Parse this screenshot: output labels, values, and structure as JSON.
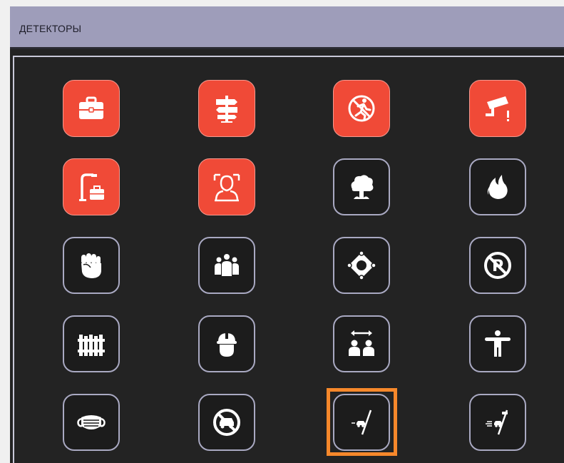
{
  "header": {
    "title": "ДЕТЕКТОРЫ"
  },
  "detectors": [
    {
      "icon": "briefcase-icon",
      "style": "red",
      "selected": false
    },
    {
      "icon": "signpost-icon",
      "style": "red",
      "selected": false
    },
    {
      "icon": "no-running-icon",
      "style": "red",
      "selected": false
    },
    {
      "icon": "camera-tamper-icon",
      "style": "red",
      "selected": false
    },
    {
      "icon": "abandoned-object-icon",
      "style": "red",
      "selected": false
    },
    {
      "icon": "face-frame-icon",
      "style": "red",
      "selected": false
    },
    {
      "icon": "smoke-icon",
      "style": "dark",
      "selected": false
    },
    {
      "icon": "fire-icon",
      "style": "dark",
      "selected": false
    },
    {
      "icon": "fist-icon",
      "style": "dark",
      "selected": false
    },
    {
      "icon": "crowd-icon",
      "style": "dark",
      "selected": false
    },
    {
      "icon": "zone-icon",
      "style": "dark",
      "selected": false
    },
    {
      "icon": "no-parking-icon",
      "style": "dark",
      "selected": false
    },
    {
      "icon": "fence-icon",
      "style": "dark",
      "selected": false
    },
    {
      "icon": "helmet-icon",
      "style": "dark",
      "selected": false
    },
    {
      "icon": "distance-icon",
      "style": "dark",
      "selected": false
    },
    {
      "icon": "t-pose-icon",
      "style": "dark",
      "selected": false
    },
    {
      "icon": "mask-icon",
      "style": "dark",
      "selected": false
    },
    {
      "icon": "no-cars-icon",
      "style": "dark",
      "selected": false
    },
    {
      "icon": "line-crossing-car-icon",
      "style": "dark",
      "selected": true
    },
    {
      "icon": "line-crossing-speed-icon",
      "style": "dark",
      "selected": false
    }
  ],
  "colors": {
    "header_bg": "#9e9dba",
    "panel_bg": "#232323",
    "tile_red": "#f04a37",
    "tile_border": "#a9a9c2",
    "selection": "#f7882b"
  }
}
